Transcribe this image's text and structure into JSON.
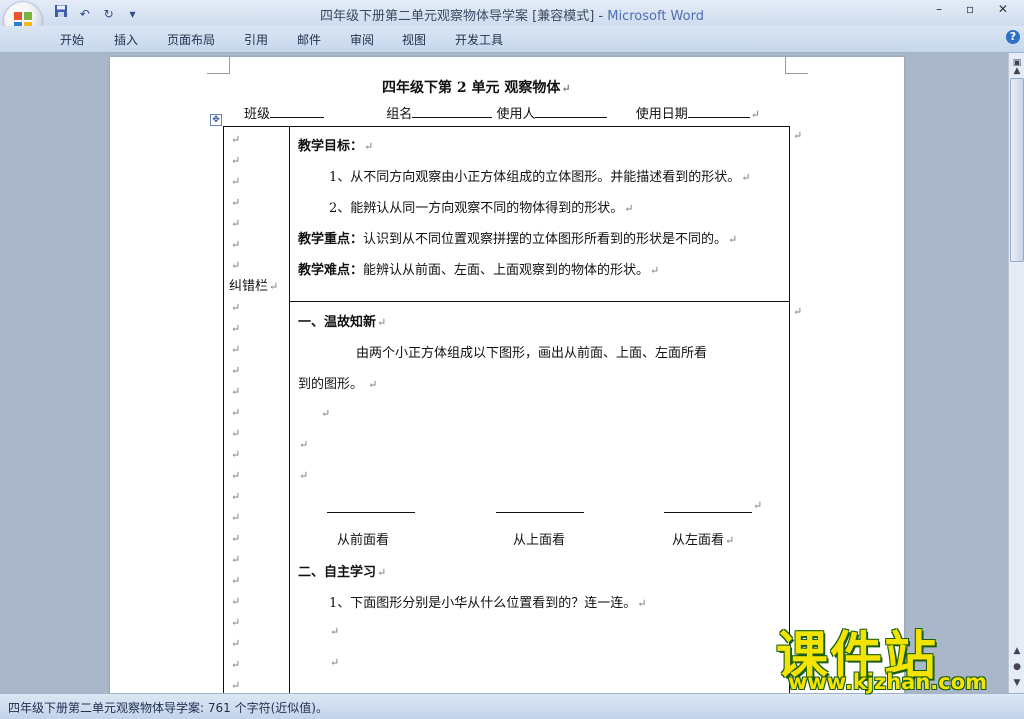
{
  "window": {
    "title_doc": "四年级下册第二单元观察物体导学案 [兼容模式] - ",
    "title_app": "Microsoft Word",
    "controls": "– ▫ ✕"
  },
  "ribbon": {
    "tabs": [
      "开始",
      "插入",
      "页面布局",
      "引用",
      "邮件",
      "审阅",
      "视图",
      "开发工具"
    ],
    "help": "?"
  },
  "quick_access": {
    "save_icon": "save-icon",
    "undo_icon": "undo-icon",
    "redo_icon": "redo-icon",
    "customize_icon": "dropdown-icon"
  },
  "document": {
    "heading": "四年级下第 2 单元      观察物体",
    "info": {
      "class_label": "班级",
      "group_label": "组名",
      "user_label": "使用人",
      "date_label": "使用日期"
    },
    "side_label": "纠错栏",
    "goals": {
      "title": "教学目标：",
      "item1": "1、从不同方向观察由小正方体组成的立体图形。并能描述看到的形状。",
      "item2": "2、能辨认从同一方向观察不同的物体得到的形状。",
      "key_label": "教学重点：",
      "key_text": "认识到从不同位置观察拼摆的立体图形所看到的形状是不同的。",
      "diff_label": "教学难点：",
      "diff_text": "能辨认从前面、左面、上面观察到的物体的形状。"
    },
    "section1": {
      "title": "一、温故知新",
      "para_line1": "由两个小正方体组成以下图形，画出从前面、上面、左面所看",
      "para_line2": "到的图形。",
      "captions": [
        "从前面看",
        "从上面看",
        "从左面看"
      ]
    },
    "section2": {
      "title": "二、自主学习",
      "item1": "1、下面图形分别是小华从什么位置看到的？连一连。"
    },
    "para_mark": "↵"
  },
  "statusbar": {
    "text": "四年级下册第二单元观察物体导学案: 761 个字符(近似值)。"
  },
  "watermark": {
    "title": "课件站",
    "url": "www.kjzhan.com"
  }
}
